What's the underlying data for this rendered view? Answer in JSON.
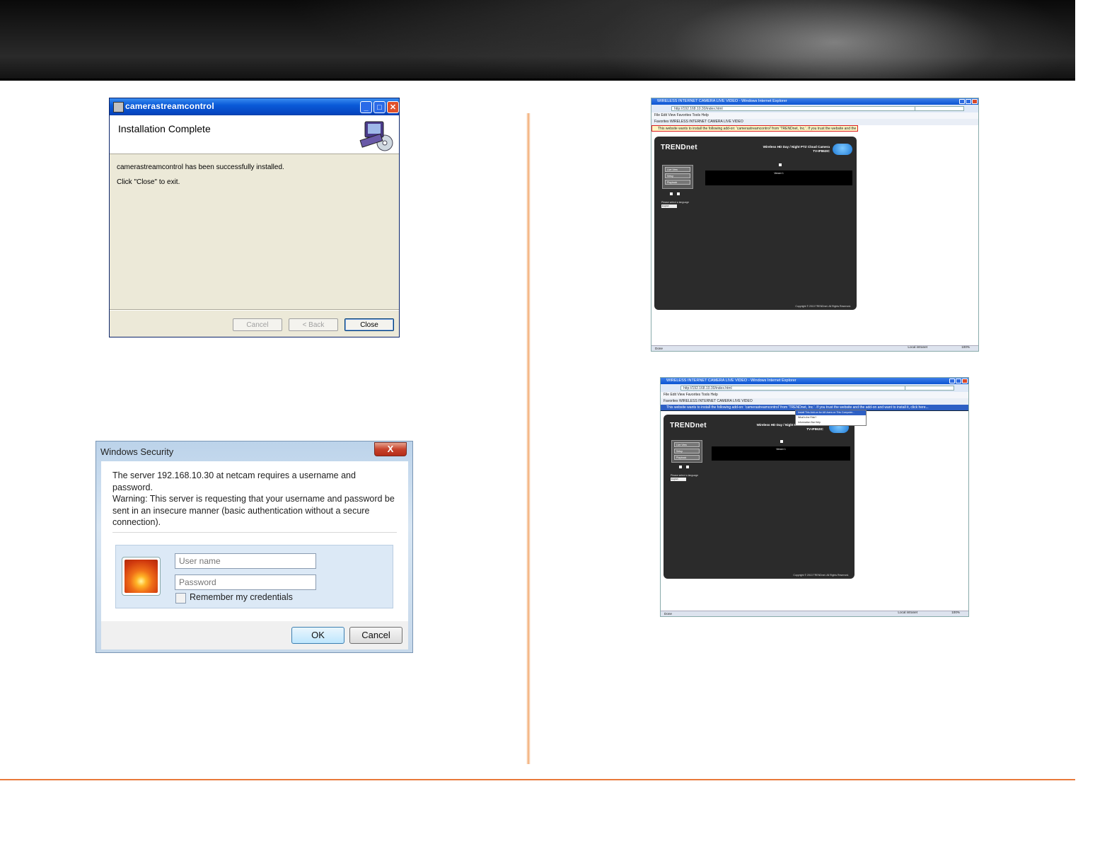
{
  "installer": {
    "title": "camerastreamcontrol",
    "heading": "Installation Complete",
    "message1": "camerastreamcontrol has been successfully installed.",
    "message2": "Click \"Close\" to exit.",
    "btn_cancel": "Cancel",
    "btn_back": "< Back",
    "btn_close": "Close",
    "minimize": "_",
    "maximize": "□",
    "close": "✕"
  },
  "security": {
    "title": "Windows Security",
    "close": "X",
    "line1": "The server 192.168.10.30 at netcam requires a username and password.",
    "warning": "Warning: This server is requesting that your username and password be sent in an insecure manner (basic authentication without a secure connection).",
    "username_placeholder": "User name",
    "password_placeholder": "Password",
    "remember": "Remember my credentials",
    "ok": "OK",
    "cancel": "Cancel"
  },
  "ie1": {
    "title": "WIRELESS INTERNET CAMERA LIVE VIDEO - Windows Internet Explorer",
    "address": "http://192.168.10.30/index.html",
    "menu": "File   Edit   View   Favorites   Tools   Help",
    "favorites": "Favorites      WIRELESS INTERNET CAMERA LIVE VIDEO",
    "info": "This website wants to install the following add-on: 'camerastreamcontrol' from 'TRENDnet, Inc.'. If you trust the website and the add-on and want to install it, click here...",
    "brand": "TRENDnet",
    "product_line1": "Wireless HD Day / Night PTZ Cloud Camera",
    "product_line2": "TV-IP862IC",
    "side_items": [
      "Live View",
      "Setup",
      "Playback"
    ],
    "video_label": "Viewer 1",
    "lang_label": "Please select a language",
    "lang_value": "English",
    "copyright": "Copyright © 2013 TRENDnet. All Rights Reserved.",
    "status": "Done",
    "zone": "Local intranet",
    "zoom": "100%"
  },
  "ie2": {
    "title": "WIRELESS INTERNET CAMERA LIVE VIDEO - Windows Internet Explorer",
    "address": "http://192.168.10.30/index.html",
    "menu": "File   Edit   View   Favorites   Tools   Help",
    "favorites": "Favorites      WIRELESS INTERNET CAMERA LIVE VIDEO",
    "info": "This website wants to install the following add-on: 'camerastreamcontrol' from 'TRENDnet, Inc.'. If you trust the website and the add-on and want to install it, click here...",
    "brand": "TRENDnet",
    "product_line1": "Wireless HD Day / Night PTZ Cloud Camera",
    "product_line2": "TV-IP862IC",
    "side_items": [
      "Live View",
      "Setup",
      "Playback"
    ],
    "video_label": "Viewer 1",
    "lang_label": "Please select a language",
    "lang_value": "English",
    "copyright": "Copyright © 2013 TRENDnet. All Rights Reserved.",
    "context_menu": [
      "Install This Add-on for All Users on This Computer...",
      "What's the Risk?",
      "Information Bar Help"
    ],
    "status": "Done",
    "zone": "Local intranet",
    "zoom": "100%"
  },
  "colors": {
    "accent_orange": "#e9793a",
    "xp_blue": "#0a5ad8",
    "highlight_red": "#e02020"
  }
}
